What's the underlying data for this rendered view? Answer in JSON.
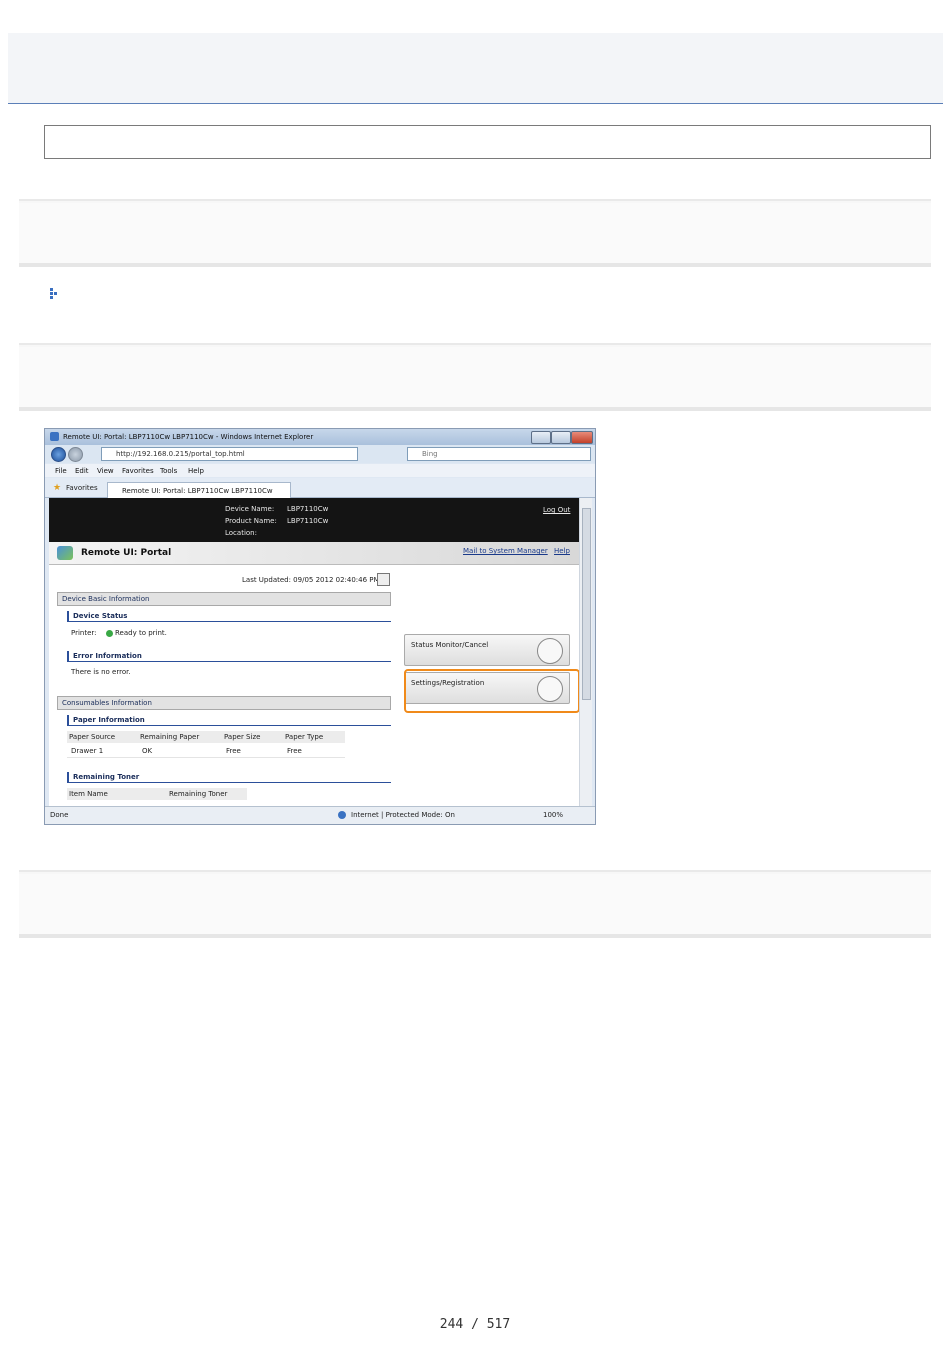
{
  "page_number": "244 / 517",
  "screenshot": {
    "window_title": "Remote UI: Portal: LBP7110Cw LBP7110Cw - Windows Internet Explorer",
    "address": "http://192.168.0.215/portal_top.html",
    "search_placeholder": "Bing",
    "menu": [
      "File",
      "Edit",
      "View",
      "Favorites",
      "Tools",
      "Help"
    ],
    "favorites_label": "Favorites",
    "tab_label": "Remote UI: Portal: LBP7110Cw LBP7110Cw",
    "device_name_label": "Device Name:",
    "device_name": "LBP7110Cw",
    "product_name_label": "Product Name:",
    "product_name": "LBP7110Cw",
    "location_label": "Location:",
    "logout": "Log Out",
    "portal_title": "Remote UI: Portal",
    "mail_link": "Mail to System Manager",
    "help_link": "Help",
    "last_updated": "Last Updated: 09/05 2012 02:40:46 PM",
    "device_basic_info": "Device Basic Information",
    "device_status": "Device Status",
    "printer_label": "Printer:",
    "printer_status": "Ready to print.",
    "error_info": "Error Information",
    "error_text": "There is no error.",
    "consumables_info": "Consumables Information",
    "paper_info": "Paper Information",
    "paper_headers": [
      "Paper Source",
      "Remaining Paper",
      "Paper Size",
      "Paper Type"
    ],
    "paper_row": [
      "Drawer 1",
      "OK",
      "Free",
      "Free"
    ],
    "remaining_toner": "Remaining Toner",
    "toner_headers": [
      "Item Name",
      "Remaining Toner"
    ],
    "status_monitor_btn": "Status Monitor/Cancel",
    "settings_btn": "Settings/Registration",
    "status_done": "Done",
    "status_zone": "Internet | Protected Mode: On",
    "zoom": "100%",
    "highlight_color": "#f08a1a"
  }
}
